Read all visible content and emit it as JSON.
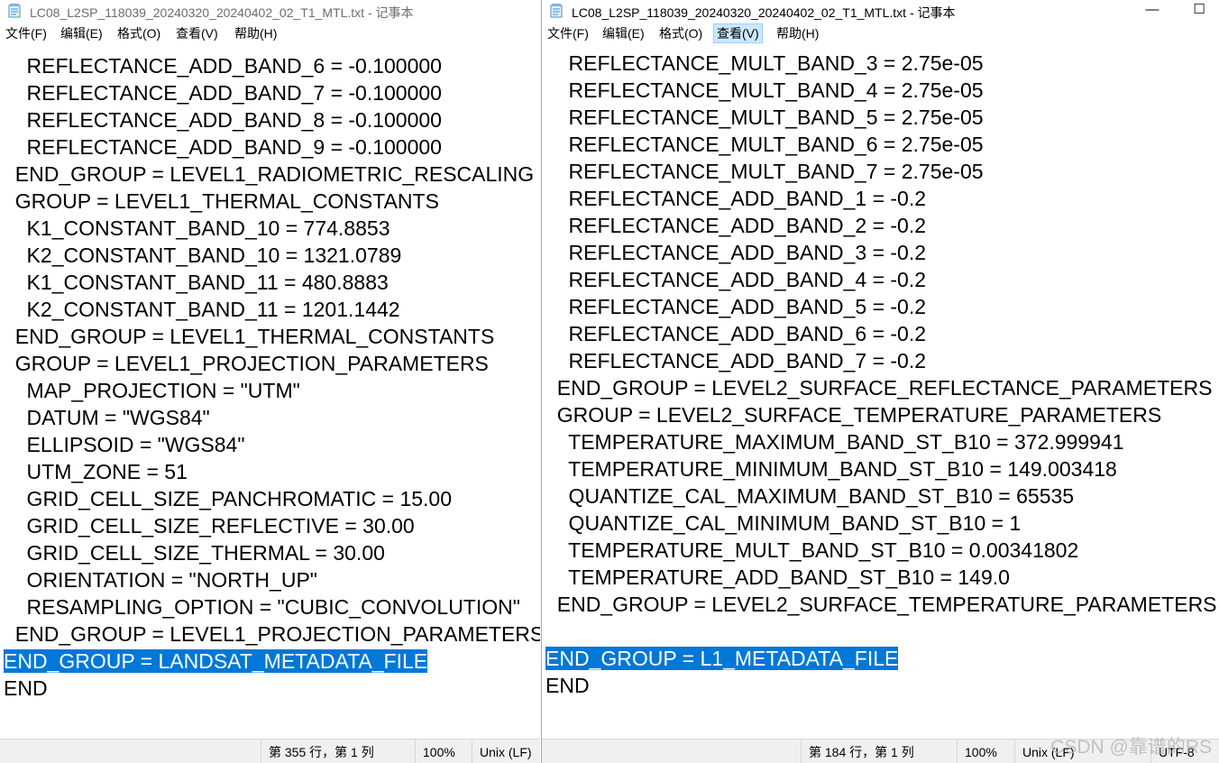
{
  "left": {
    "title": "LC08_L2SP_118039_20240320_20240402_02_T1_MTL.txt - 记事本",
    "menu": [
      "文件(F)",
      "编辑(E)",
      "格式(O)",
      "查看(V)",
      "帮助(H)"
    ],
    "lines": [
      {
        "text": "    REFLECTANCE_ADD_BAND_6 = -0.100000",
        "selected": false
      },
      {
        "text": "    REFLECTANCE_ADD_BAND_7 = -0.100000",
        "selected": false
      },
      {
        "text": "    REFLECTANCE_ADD_BAND_8 = -0.100000",
        "selected": false
      },
      {
        "text": "    REFLECTANCE_ADD_BAND_9 = -0.100000",
        "selected": false
      },
      {
        "text": "  END_GROUP = LEVEL1_RADIOMETRIC_RESCALING",
        "selected": false
      },
      {
        "text": "  GROUP = LEVEL1_THERMAL_CONSTANTS",
        "selected": false
      },
      {
        "text": "    K1_CONSTANT_BAND_10 = 774.8853",
        "selected": false
      },
      {
        "text": "    K2_CONSTANT_BAND_10 = 1321.0789",
        "selected": false
      },
      {
        "text": "    K1_CONSTANT_BAND_11 = 480.8883",
        "selected": false
      },
      {
        "text": "    K2_CONSTANT_BAND_11 = 1201.1442",
        "selected": false
      },
      {
        "text": "  END_GROUP = LEVEL1_THERMAL_CONSTANTS",
        "selected": false
      },
      {
        "text": "  GROUP = LEVEL1_PROJECTION_PARAMETERS",
        "selected": false
      },
      {
        "text": "    MAP_PROJECTION = \"UTM\"",
        "selected": false
      },
      {
        "text": "    DATUM = \"WGS84\"",
        "selected": false
      },
      {
        "text": "    ELLIPSOID = \"WGS84\"",
        "selected": false
      },
      {
        "text": "    UTM_ZONE = 51",
        "selected": false
      },
      {
        "text": "    GRID_CELL_SIZE_PANCHROMATIC = 15.00",
        "selected": false
      },
      {
        "text": "    GRID_CELL_SIZE_REFLECTIVE = 30.00",
        "selected": false
      },
      {
        "text": "    GRID_CELL_SIZE_THERMAL = 30.00",
        "selected": false
      },
      {
        "text": "    ORIENTATION = \"NORTH_UP\"",
        "selected": false
      },
      {
        "text": "    RESAMPLING_OPTION = \"CUBIC_CONVOLUTION\"",
        "selected": false
      },
      {
        "text": "  END_GROUP = LEVEL1_PROJECTION_PARAMETERS",
        "selected": false
      },
      {
        "text": "END_GROUP = LANDSAT_METADATA_FILE",
        "selected": true
      },
      {
        "text": "END",
        "selected": false
      }
    ],
    "status": {
      "position": "第 355 行，第 1 列",
      "zoom": "100%",
      "eol": "Unix (LF)"
    }
  },
  "right": {
    "title": "LC08_L2SP_118039_20240320_20240402_02_T1_MTL.txt - 记事本",
    "controls": {
      "minimize": "—",
      "maximize": "☐"
    },
    "menu": [
      "文件(F)",
      "编辑(E)",
      "格式(O)",
      "查看(V)",
      "帮助(H)"
    ],
    "active_menu_index": 3,
    "lines": [
      {
        "text": "    REFLECTANCE_MULT_BAND_3 = 2.75e-05",
        "selected": false
      },
      {
        "text": "    REFLECTANCE_MULT_BAND_4 = 2.75e-05",
        "selected": false
      },
      {
        "text": "    REFLECTANCE_MULT_BAND_5 = 2.75e-05",
        "selected": false
      },
      {
        "text": "    REFLECTANCE_MULT_BAND_6 = 2.75e-05",
        "selected": false
      },
      {
        "text": "    REFLECTANCE_MULT_BAND_7 = 2.75e-05",
        "selected": false
      },
      {
        "text": "    REFLECTANCE_ADD_BAND_1 = -0.2",
        "selected": false
      },
      {
        "text": "    REFLECTANCE_ADD_BAND_2 = -0.2",
        "selected": false
      },
      {
        "text": "    REFLECTANCE_ADD_BAND_3 = -0.2",
        "selected": false
      },
      {
        "text": "    REFLECTANCE_ADD_BAND_4 = -0.2",
        "selected": false
      },
      {
        "text": "    REFLECTANCE_ADD_BAND_5 = -0.2",
        "selected": false
      },
      {
        "text": "    REFLECTANCE_ADD_BAND_6 = -0.2",
        "selected": false
      },
      {
        "text": "    REFLECTANCE_ADD_BAND_7 = -0.2",
        "selected": false
      },
      {
        "text": "  END_GROUP = LEVEL2_SURFACE_REFLECTANCE_PARAMETERS",
        "selected": false
      },
      {
        "text": "  GROUP = LEVEL2_SURFACE_TEMPERATURE_PARAMETERS",
        "selected": false
      },
      {
        "text": "    TEMPERATURE_MAXIMUM_BAND_ST_B10 = 372.999941",
        "selected": false
      },
      {
        "text": "    TEMPERATURE_MINIMUM_BAND_ST_B10 = 149.003418",
        "selected": false
      },
      {
        "text": "    QUANTIZE_CAL_MAXIMUM_BAND_ST_B10 = 65535",
        "selected": false
      },
      {
        "text": "    QUANTIZE_CAL_MINIMUM_BAND_ST_B10 = 1",
        "selected": false
      },
      {
        "text": "    TEMPERATURE_MULT_BAND_ST_B10 = 0.00341802",
        "selected": false
      },
      {
        "text": "    TEMPERATURE_ADD_BAND_ST_B10 = 149.0",
        "selected": false
      },
      {
        "text": "  END_GROUP = LEVEL2_SURFACE_TEMPERATURE_PARAMETERS",
        "selected": false
      },
      {
        "text": "",
        "selected": false
      },
      {
        "text": "END_GROUP = L1_METADATA_FILE",
        "selected": true
      },
      {
        "text": "END",
        "selected": false
      }
    ],
    "status": {
      "position": "第 184 行，第 1 列",
      "zoom": "100%",
      "eol": "Unix (LF)",
      "encoding": "UTF-8"
    }
  },
  "watermark": "CSDN @靠谱的RS",
  "colors": {
    "selection": "#0078d7",
    "status_bg": "#f0f0f0",
    "menu_active_bg": "#cce8ff"
  }
}
